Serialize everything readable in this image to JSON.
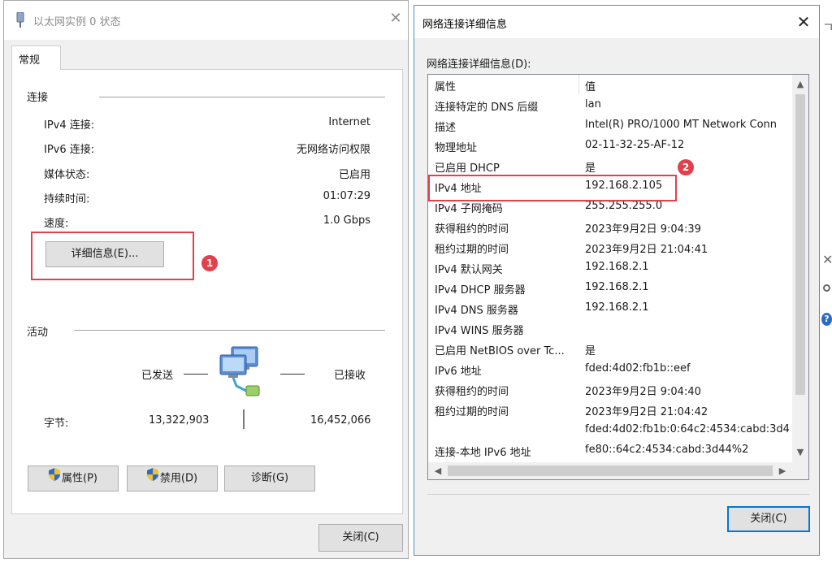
{
  "left_window": {
    "title": "以太网实例 0 状态",
    "tab": "常规",
    "connection_group": "连接",
    "rows": [
      {
        "label": "IPv4 连接:",
        "value": "Internet"
      },
      {
        "label": "IPv6 连接:",
        "value": "无网络访问权限"
      },
      {
        "label": "媒体状态:",
        "value": "已启用"
      },
      {
        "label": "持续时间:",
        "value": "01:07:29"
      },
      {
        "label": "速度:",
        "value": "1.0 Gbps"
      }
    ],
    "details_button": "详细信息(E)...",
    "activity_group": "活动",
    "sent_label": "已发送",
    "received_label": "已接收",
    "bytes_label": "字节:",
    "bytes_sent": "13,322,903",
    "bytes_received": "16,452,066",
    "buttons": {
      "properties": "属性(P)",
      "disable": "禁用(D)",
      "diagnose": "诊断(G)",
      "close": "关闭(C)"
    },
    "marker": "1"
  },
  "right_window": {
    "title": "网络连接详细信息",
    "list_label": "网络连接详细信息(D):",
    "columns": [
      "属性",
      "值"
    ],
    "rows": [
      {
        "prop": "连接特定的 DNS 后缀",
        "value": "lan"
      },
      {
        "prop": "描述",
        "value": "Intel(R) PRO/1000 MT Network Conn"
      },
      {
        "prop": "物理地址",
        "value": "02-11-32-25-AF-12"
      },
      {
        "prop": "已启用 DHCP",
        "value": "是"
      },
      {
        "prop": "IPv4 地址",
        "value": "192.168.2.105"
      },
      {
        "prop": "IPv4 子网掩码",
        "value": "255.255.255.0"
      },
      {
        "prop": "获得租约的时间",
        "value": "2023年9月2日 9:04:39"
      },
      {
        "prop": "租约过期的时间",
        "value": "2023年9月2日 21:04:41"
      },
      {
        "prop": "IPv4 默认网关",
        "value": "192.168.2.1"
      },
      {
        "prop": "IPv4 DHCP 服务器",
        "value": "192.168.2.1"
      },
      {
        "prop": "IPv4 DNS 服务器",
        "value": "192.168.2.1"
      },
      {
        "prop": "IPv4 WINS 服务器",
        "value": ""
      },
      {
        "prop": "已启用 NetBIOS over Tc...",
        "value": "是"
      },
      {
        "prop": "IPv6 地址",
        "value": "fded:4d02:fb1b::eef"
      },
      {
        "prop": "获得租约的时间",
        "value": "2023年9月2日 9:04:40"
      },
      {
        "prop": "租约过期的时间",
        "value": "2023年9月2日 21:04:42"
      },
      {
        "prop": "",
        "value": "fded:4d02:fb1b:0:64c2:4534:cabd:3d4"
      },
      {
        "prop": "连接-本地 IPv6 地址",
        "value": "fe80::64c2:4534:cabd:3d44%2"
      }
    ],
    "close_button": "关闭(C)",
    "marker": "2"
  },
  "colors": {
    "highlight": "#e2404a",
    "window_border": "#4a90c9",
    "shield_blue": "#2b6cc4",
    "shield_yellow": "#f2c12e"
  }
}
